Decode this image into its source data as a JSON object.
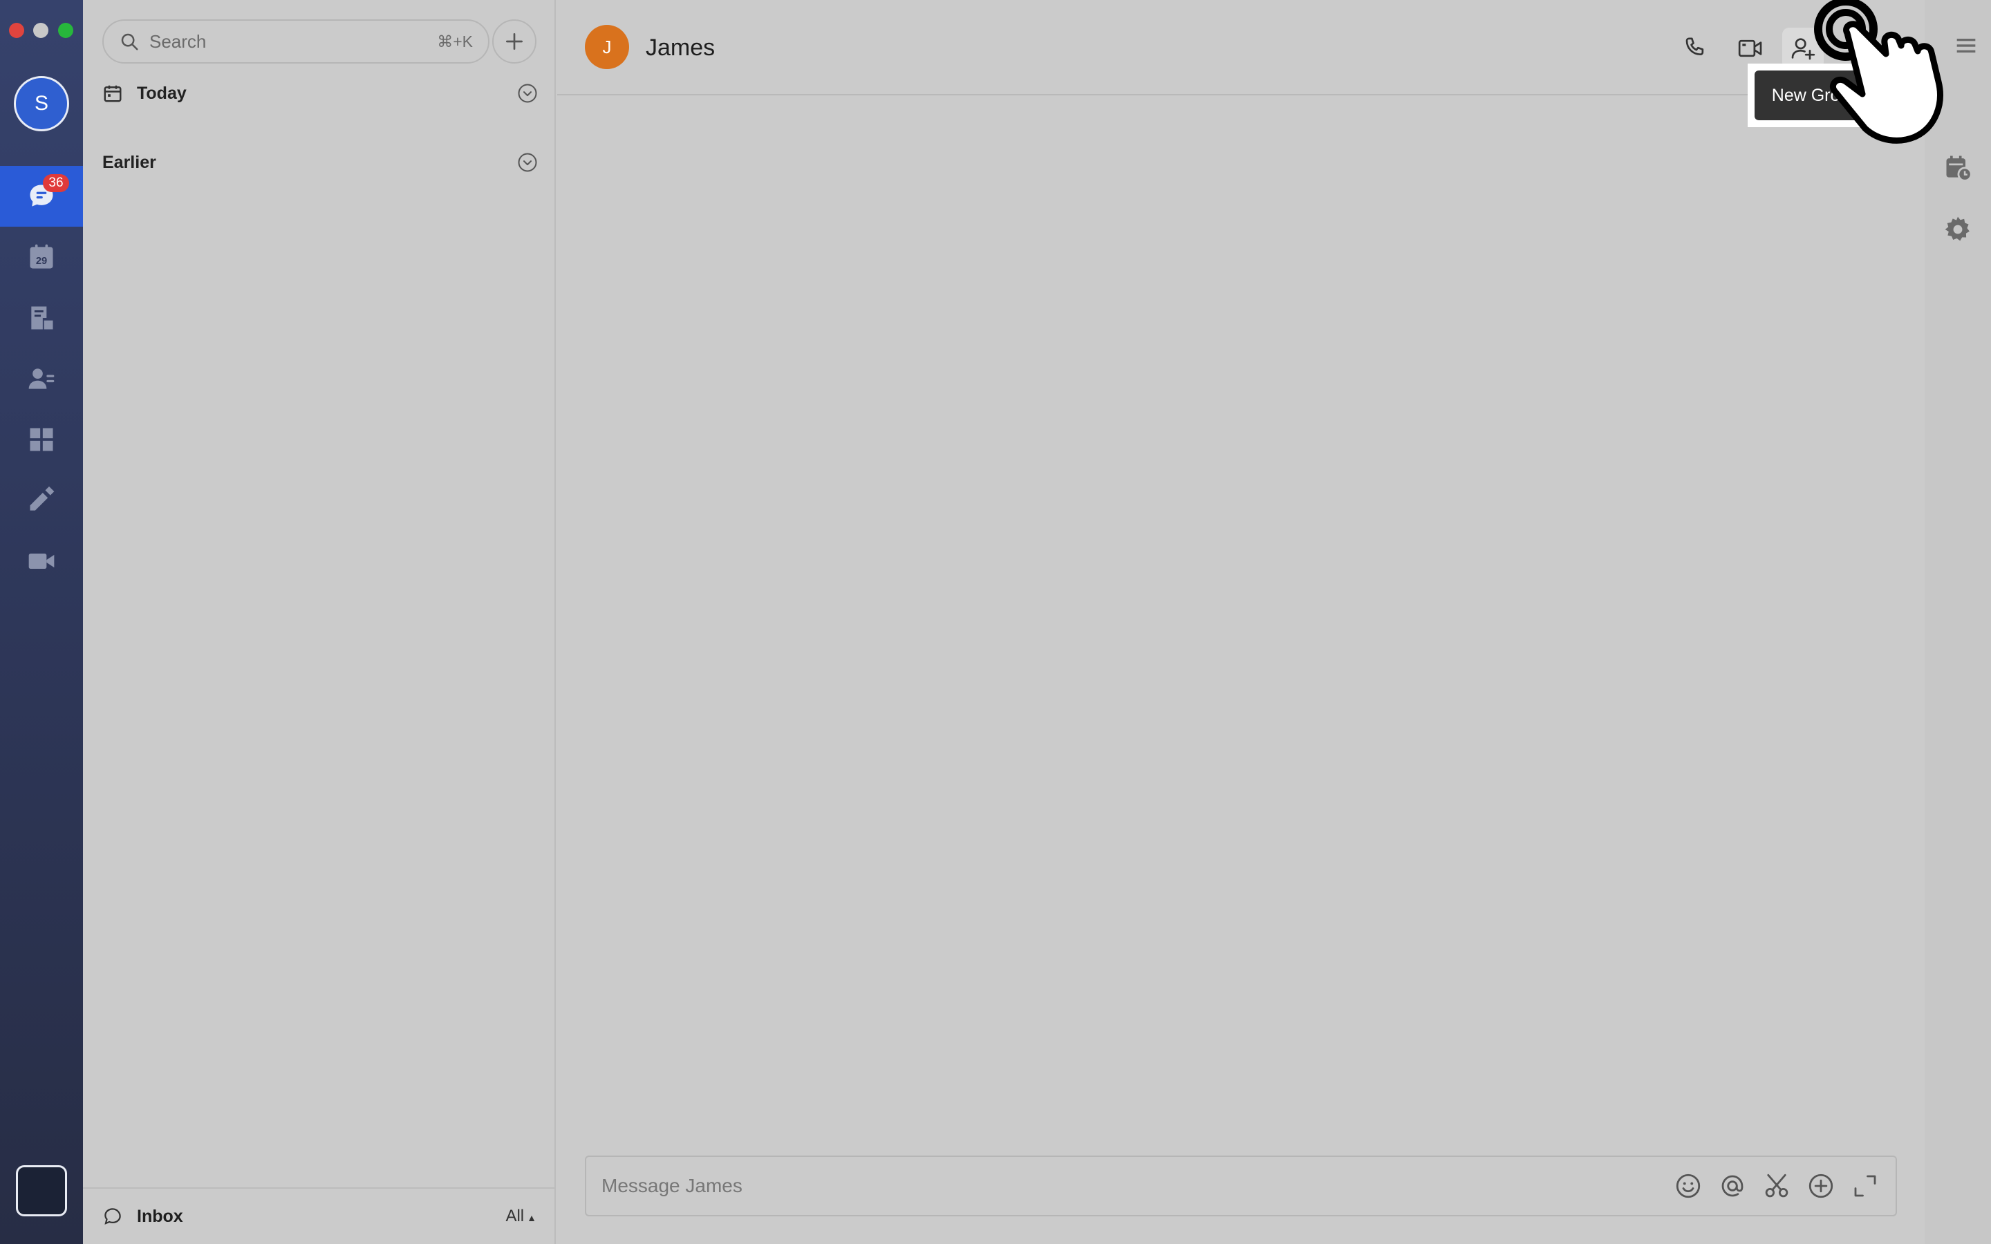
{
  "rail": {
    "avatar_initial": "S",
    "chat_badge": "36",
    "calendar_day": "29",
    "items": [
      {
        "name": "chat-icon"
      },
      {
        "name": "calendar-icon"
      },
      {
        "name": "docs-icon"
      },
      {
        "name": "contacts-icon"
      },
      {
        "name": "apps-icon"
      },
      {
        "name": "whiteboard-icon"
      },
      {
        "name": "meetings-icon"
      }
    ]
  },
  "list": {
    "search_placeholder": "Search",
    "search_shortcut": "⌘+K",
    "sections": [
      {
        "label": "Today"
      },
      {
        "label": "Earlier"
      }
    ],
    "footer": {
      "inbox_label": "Inbox",
      "filter_label": "All"
    }
  },
  "chat": {
    "contact_initial": "J",
    "contact_name": "James",
    "tooltip": "New Group",
    "composer_placeholder": "Message James"
  },
  "colors": {
    "accent": "#2a5bd7",
    "badge": "#e03a3a",
    "contact_avatar": "#d9721d",
    "background": "#cbcbcb"
  }
}
